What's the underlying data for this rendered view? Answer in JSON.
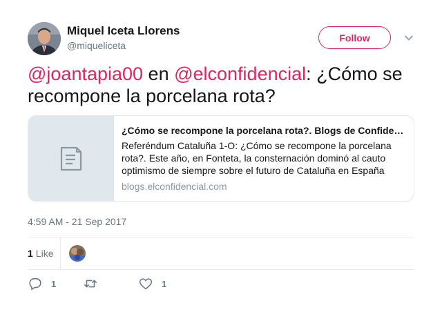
{
  "author": {
    "name": "Miquel Iceta Llorens",
    "handle": "@miqueliceta"
  },
  "follow_label": "Follow",
  "tweet": {
    "mention1": "@joantapia00",
    "connector": " en ",
    "mention2": "@elconfidencial",
    "text": ": ¿Cómo se recompone la porcelana rota?"
  },
  "card": {
    "title": "¿Cómo se recompone la porcelana rota?. Blogs de Confidencias Catalanas",
    "description": "Referéndum Cataluña 1-O: ¿Cómo se recompone la porcelana rota?. Este año, en Fonteta, la consternación dominó al cauto optimismo de siempre sobre el futuro de Cataluña en España",
    "domain": "blogs.elconfidencial.com"
  },
  "timestamp": "4:59 AM - 21 Sep 2017",
  "stats": {
    "likes_count": "1",
    "likes_label": "Like"
  },
  "actions": {
    "reply_count": "1",
    "like_count": "1"
  },
  "colors": {
    "accent": "#e0245e",
    "muted": "#657786",
    "border": "#e1e8ed"
  },
  "icons": {
    "chevron": "chevron-down-icon",
    "card_placeholder": "document-icon",
    "reply": "reply-icon",
    "retweet": "retweet-icon",
    "like": "heart-icon"
  }
}
